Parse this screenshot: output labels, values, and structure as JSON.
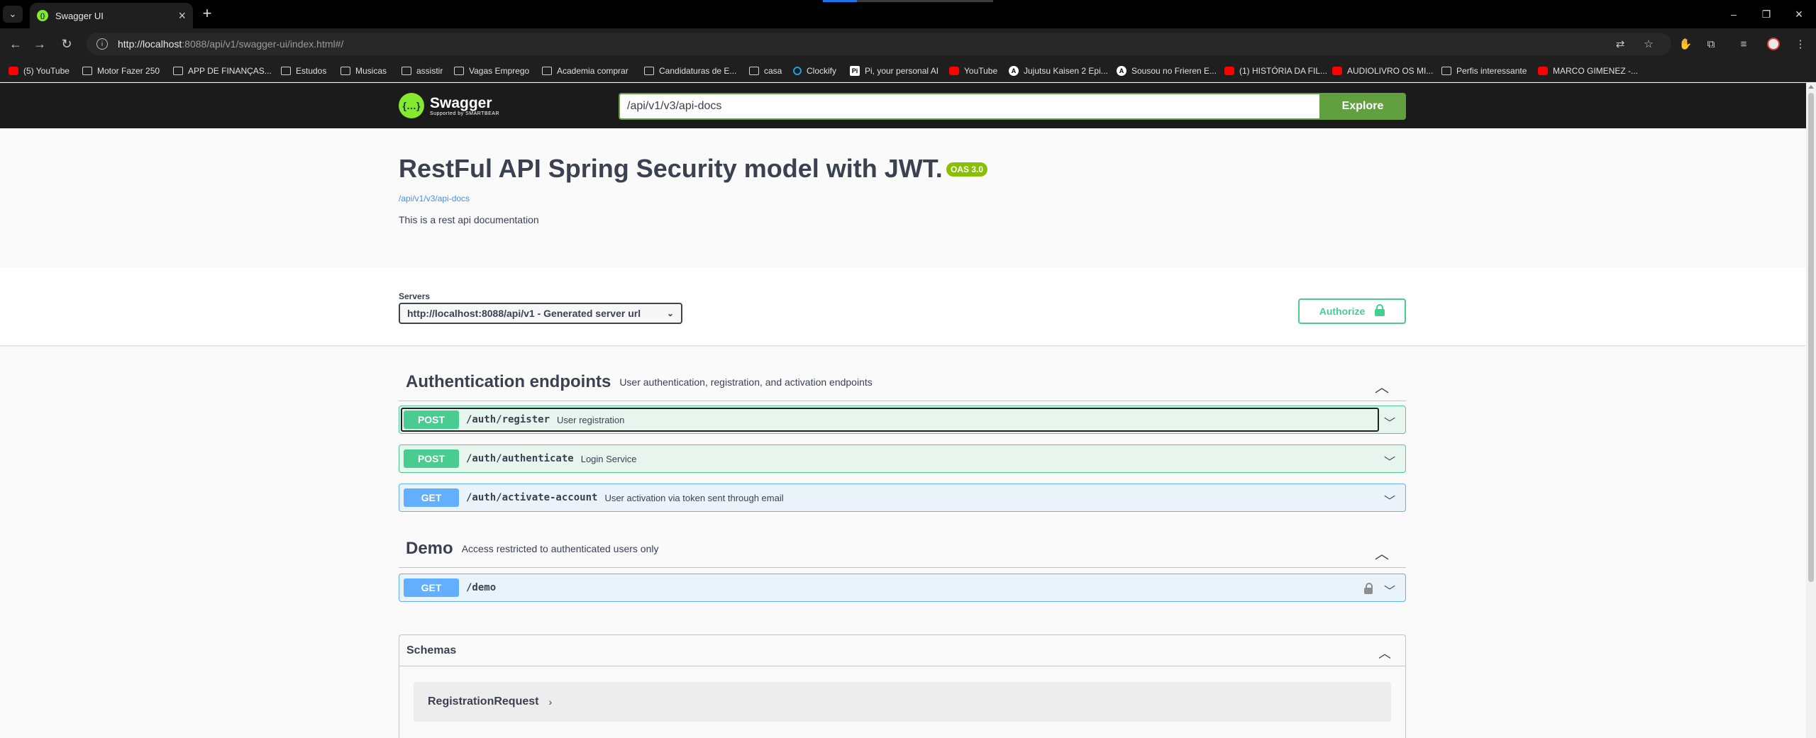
{
  "browser": {
    "tab_dropdown_icon": "chevron-down-icon",
    "tab_title": "Swagger UI",
    "tab_close": "×",
    "new_tab": "+",
    "window_controls": [
      "–",
      "❐",
      "×"
    ],
    "url_host": "http://localhost",
    "url_path": ":8088/api/v1/swagger-ui/index.html#/"
  },
  "bookmarks": [
    {
      "label": "(5) YouTube",
      "icon": "youtube-icon"
    },
    {
      "label": "Motor Fazer 250",
      "icon": "folder-icon"
    },
    {
      "label": "APP DE FINANÇAS...",
      "icon": "folder-icon"
    },
    {
      "label": "Estudos",
      "icon": "folder-icon"
    },
    {
      "label": "Musicas",
      "icon": "folder-icon"
    },
    {
      "label": "assistir",
      "icon": "folder-icon"
    },
    {
      "label": "Vagas Emprego",
      "icon": "folder-icon"
    },
    {
      "label": "Academia comprar",
      "icon": "folder-icon"
    },
    {
      "label": "Candidaturas de E...",
      "icon": "folder-icon"
    },
    {
      "label": "casa",
      "icon": "folder-icon"
    },
    {
      "label": "Clockify",
      "icon": "clockify-icon"
    },
    {
      "label": "Pi, your personal AI",
      "icon": "pi-icon"
    },
    {
      "label": "YouTube",
      "icon": "youtube-icon"
    },
    {
      "label": "Jujutsu Kaisen 2 Epi...",
      "icon": "anime-icon"
    },
    {
      "label": "Sousou no Frieren E...",
      "icon": "anime-icon"
    },
    {
      "label": "(1) HISTÓRIA DA FIL...",
      "icon": "youtube-icon"
    },
    {
      "label": "AUDIOLIVRO OS MI...",
      "icon": "youtube-icon"
    },
    {
      "label": "Perfis interessante",
      "icon": "folder-icon"
    },
    {
      "label": "MARCO GIMENEZ -...",
      "icon": "youtube-icon"
    }
  ],
  "swagger": {
    "logo_name": "Swagger",
    "logo_sub": "Supported by SMARTBEAR",
    "spec_url": "/api/v1/v3/api-docs",
    "explore_label": "Explore"
  },
  "info": {
    "title": "RestFul API Spring Security model with JWT.",
    "oas_badge": "OAS 3.0",
    "spec_link": "/api/v1/v3/api-docs",
    "description": "This is a rest api documentation"
  },
  "servers": {
    "label": "Servers",
    "selected": "http://localhost:8088/api/v1 - Generated server url",
    "authorize_label": "Authorize"
  },
  "tags": [
    {
      "name": "Authentication endpoints",
      "description": "User authentication, registration, and activation endpoints",
      "operations": [
        {
          "method": "POST",
          "path": "/auth/register",
          "summary": "User registration"
        },
        {
          "method": "POST",
          "path": "/auth/authenticate",
          "summary": "Login Service"
        },
        {
          "method": "GET",
          "path": "/auth/activate-account",
          "summary": "User activation via token sent through email"
        }
      ]
    },
    {
      "name": "Demo",
      "description": "Access restricted to authenticated users only",
      "operations": [
        {
          "method": "GET",
          "path": "/demo",
          "summary": ""
        }
      ]
    }
  ],
  "schemas": {
    "title": "Schemas",
    "items": [
      "RegistrationRequest"
    ]
  },
  "colors": {
    "post": "#49cc90",
    "get": "#61affe",
    "explore": "#62a03f",
    "topbar": "#1b1b1b"
  }
}
